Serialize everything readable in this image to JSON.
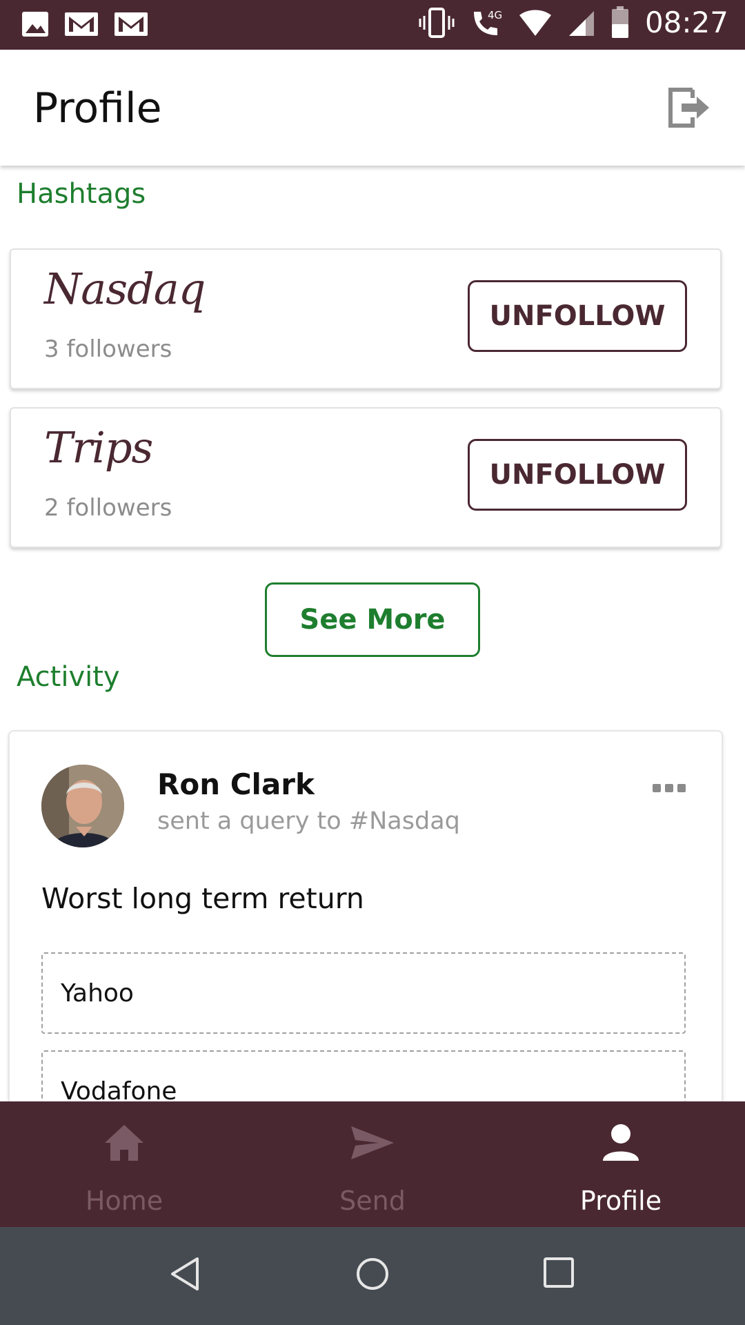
{
  "status_bar": {
    "time": "08:27",
    "network": "4G",
    "left_icons": [
      "image-icon",
      "gmail-icon",
      "gmail-icon"
    ],
    "right_icons": [
      "vibrate-icon",
      "wifi-call-icon",
      "wifi-icon",
      "signal-icon",
      "battery-icon"
    ]
  },
  "header": {
    "title": "Profile",
    "logout_icon": "logout-icon"
  },
  "hashtags": {
    "section_label": "Hashtags",
    "items": [
      {
        "name": "Nasdaq",
        "followers": "3 followers",
        "button_label": "UNFOLLOW"
      },
      {
        "name": "Trips",
        "followers": "2 followers",
        "button_label": "UNFOLLOW"
      }
    ],
    "see_more_label": "See More"
  },
  "activity": {
    "section_label": "Activity",
    "post": {
      "author": "Ron Clark",
      "action": "sent a query to #Nasdaq",
      "query": "Worst long term return",
      "options": [
        "Yahoo",
        "Vodafone"
      ]
    }
  },
  "bottom_nav": {
    "items": [
      {
        "label": "Home",
        "icon": "home-icon",
        "active": false
      },
      {
        "label": "Send",
        "icon": "send-icon",
        "active": false
      },
      {
        "label": "Profile",
        "icon": "person-icon",
        "active": true
      }
    ]
  },
  "colors": {
    "brand": "#4a2832",
    "accent_green": "#1e7e2e",
    "system_nav": "#454b51"
  }
}
